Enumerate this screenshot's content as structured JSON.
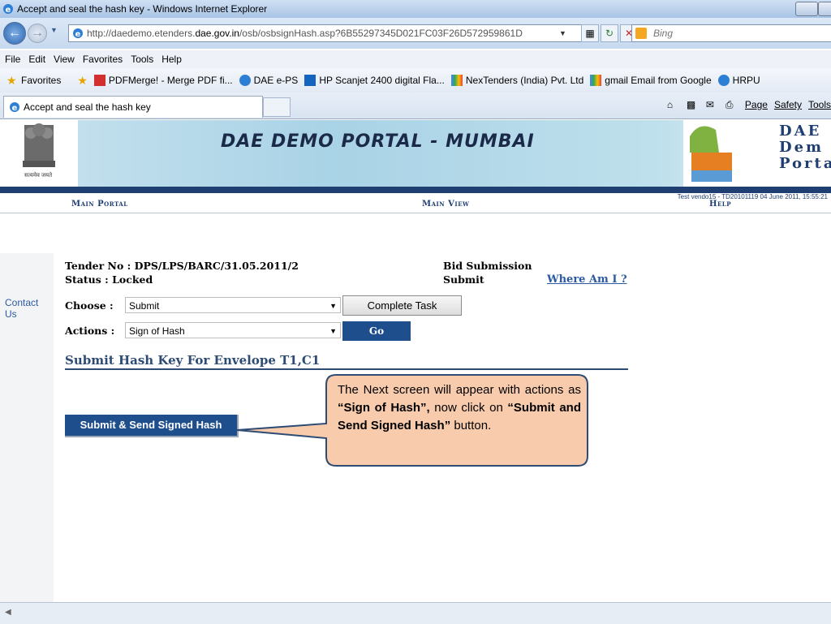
{
  "window": {
    "title": "Accept and seal the hash key - Windows Internet Explorer"
  },
  "address": {
    "url_prefix": "http://daedemo.etenders.",
    "url_domain": "dae.gov.in",
    "url_suffix": "/osb/osbsignHash.asp?6B55297345D021FC03F26D572959861D",
    "search_placeholder": "Bing"
  },
  "menu": {
    "items": [
      "File",
      "Edit",
      "View",
      "Favorites",
      "Tools",
      "Help"
    ]
  },
  "favorites": {
    "label": "Favorites",
    "items": [
      "PDFMerge! - Merge PDF fi...",
      "DAE e-PS",
      "HP Scanjet 2400 digital Fla...",
      "NexTenders (India) Pvt. Ltd",
      "gmail Email from Google",
      "HRPU"
    ]
  },
  "tab": {
    "label": "Accept and seal the hash key"
  },
  "commandbar": {
    "page": "Page",
    "safety": "Safety",
    "tools": "Tools"
  },
  "banner": {
    "title": "DAE DEMO PORTAL - MUMBAI",
    "logo_text_1": "DAE",
    "logo_text_2": "Dem",
    "logo_text_3": "Porta",
    "emblem_caption": "सत्यमेव जयते",
    "info": "Test vendo15 - TD20101119     04 June 2011,  15:55:21"
  },
  "nav": {
    "main_portal": "Main Portal",
    "main_view": "Main View",
    "help": "Help"
  },
  "sidebar": {
    "contact": "Contact Us"
  },
  "tender": {
    "tender_no": "Tender No : DPS/LPS/BARC/31.05.2011/2",
    "status": "Status : Locked",
    "stage_label": "Bid Submission",
    "stage_value": "Submit",
    "where_am_i": "Where Am I ?"
  },
  "form": {
    "choose_label": "Choose :",
    "choose_value": "Submit",
    "complete_task": "Complete Task",
    "actions_label": "Actions :",
    "actions_value": "Sign of Hash",
    "go": "Go"
  },
  "section": {
    "title": "Submit Hash Key For Envelope T1,C1",
    "submit_button": "Submit & Send Signed Hash"
  },
  "callout": {
    "part1": "The Next screen will appear  with actions as ",
    "bold1": "“Sign of Hash”,",
    "part2": " now click on ",
    "bold2": "“Submit and Send Signed Hash”",
    "part3": " button."
  }
}
